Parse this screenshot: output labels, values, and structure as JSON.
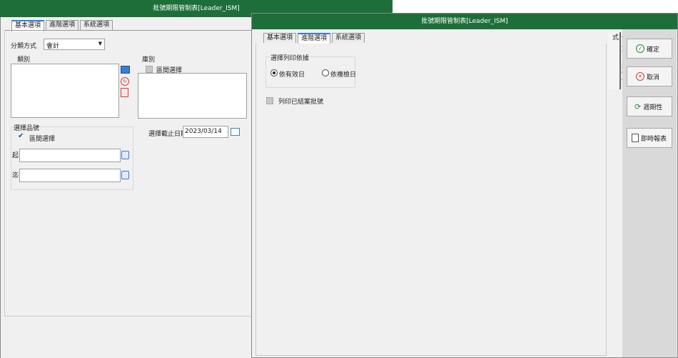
{
  "back_window": {
    "title": "批號期限管制表[Leader_ISM]",
    "tabs": [
      "基本選項",
      "進階選項",
      "系統選項"
    ],
    "classify_label": "分類方式",
    "classify_value": "會計",
    "category_label": "類別",
    "warehouse_label": "庫別",
    "warehouse_range_label": "區間選擇",
    "product_group_label": "選擇品號",
    "product_range_label": "區間選擇",
    "from_label": "起",
    "to_label": "迄",
    "date_label": "選擇截止日期",
    "date_value": "2023/03/14"
  },
  "front_window": {
    "title": "批號期限管制表[Leader_ISM]",
    "tabs": [
      "基本選項",
      "進階選項",
      "系統選項"
    ],
    "print_basis_label": "選擇列印依據",
    "radio_expiry": "依有效日",
    "radio_recheck": "依複檢日",
    "print_closed_label": "列印已結案批號",
    "side_tab_label": "使用者自訂條件式"
  },
  "actions": {
    "confirm": "確定",
    "cancel": "取消",
    "cycle": "週期性",
    "report": "即時報表"
  },
  "colors": {
    "titlebar": "#1e6e3a",
    "active_tab": "#3a7bd5",
    "delete_icon": "#d83b3b"
  }
}
